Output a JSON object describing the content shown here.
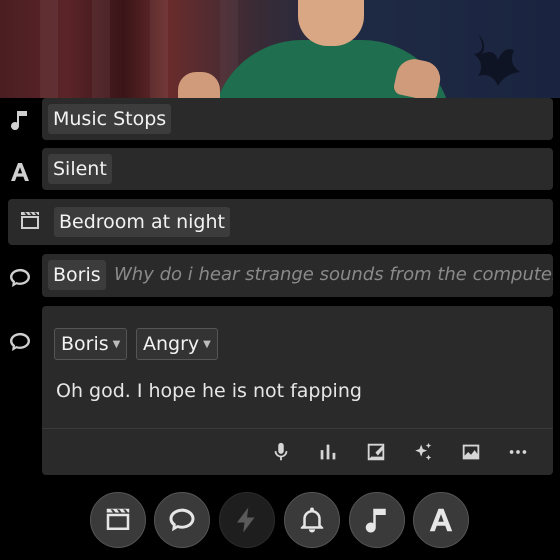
{
  "rows": {
    "music": {
      "icon": "music-note-icon",
      "label": "Music Stops"
    },
    "sound": {
      "icon": "letter-a-icon",
      "label": "Silent"
    },
    "scene": {
      "icon": "clapperboard-icon",
      "label": "Bedroom at night"
    },
    "speech": {
      "icon": "speech-bubble-icon",
      "speaker": "Boris",
      "text": "Why do i hear strange sounds from the computer r"
    }
  },
  "editor": {
    "icon": "speech-bubble-icon",
    "speaker_select": "Boris",
    "emotion_select": "Angry",
    "text": "Oh god. I hope he is not fapping",
    "tools": [
      "microphone-icon",
      "bar-chart-icon",
      "image-contrast-icon",
      "sparkles-icon",
      "image-icon",
      "more-icon"
    ]
  },
  "bottom_bar": [
    "clapperboard-icon",
    "speech-bubble-icon",
    "lightning-icon",
    "bell-icon",
    "music-note-icon",
    "letter-a-icon"
  ]
}
